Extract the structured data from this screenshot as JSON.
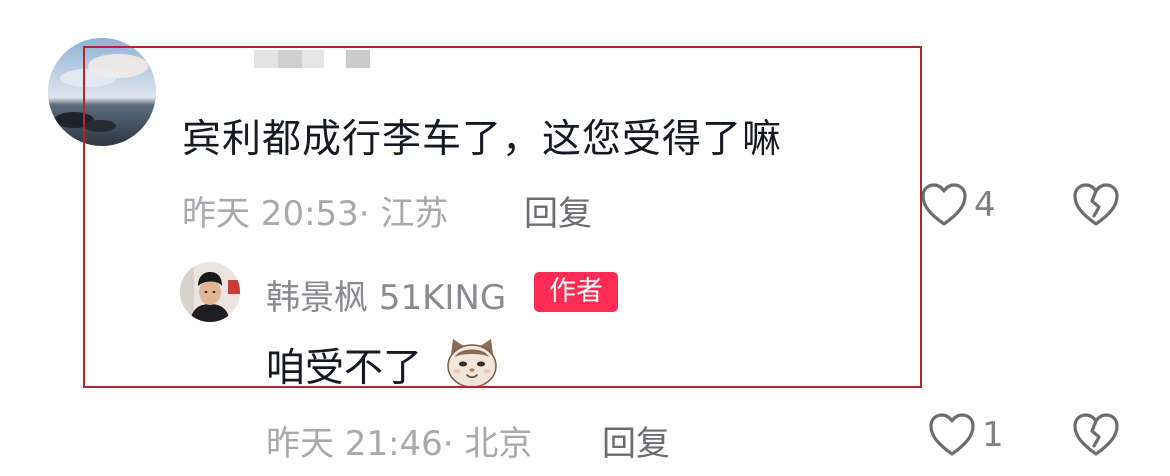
{
  "comment": {
    "text": "宾利都成行李车了，这您受得了嘛",
    "time": "昨天 20:53",
    "location": "江苏",
    "meta": "昨天 20:53· 江苏",
    "reply_label": "回复",
    "likes": "4",
    "avatar_icon": "seascape-avatar",
    "like_icon": "heart-outline-icon",
    "dislike_icon": "broken-heart-icon"
  },
  "reply": {
    "author": "韩景枫 51KING",
    "badge": "作者",
    "text": "咱受不了",
    "emoji": "cat-emoji",
    "time": "昨天 21:46",
    "location": "北京",
    "meta": "昨天 21:46· 北京",
    "reply_label": "回复",
    "likes": "1"
  },
  "colors": {
    "badge_bg": "#fe2c55",
    "highlight_border": "#b3262a",
    "primary_text": "#161823",
    "secondary_text": "#a8a8ad"
  }
}
